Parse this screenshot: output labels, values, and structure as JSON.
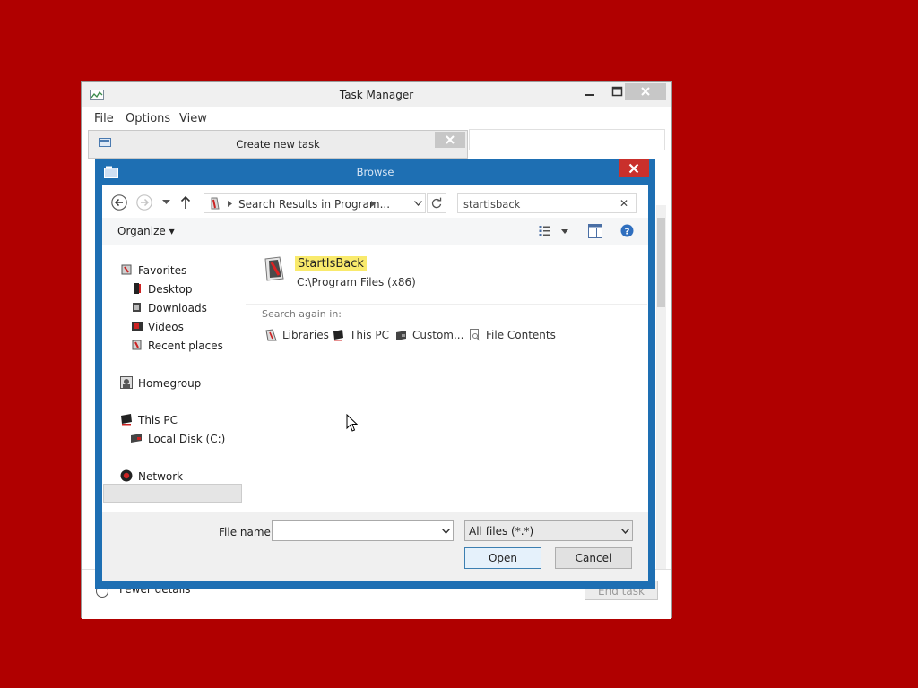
{
  "task_manager": {
    "title": "Task Manager",
    "menu": [
      "File",
      "Options",
      "View"
    ],
    "fewer_details": "Fewer details",
    "end_task": "End task"
  },
  "create_task": {
    "title": "Create new task"
  },
  "browse": {
    "title": "Browse",
    "address": "Search Results in Program...",
    "search_value": "startisback",
    "organize": "Organize",
    "nav": {
      "favorites": "Favorites",
      "desktop": "Desktop",
      "downloads": "Downloads",
      "videos": "Videos",
      "recent": "Recent places",
      "homegroup": "Homegroup",
      "this_pc": "This PC",
      "local_disk": "Local Disk (C:)",
      "network": "Network"
    },
    "result": {
      "name": "StartIsBack",
      "path": "C:\\Program Files (x86)"
    },
    "search_again": {
      "label": "Search again in:",
      "options": [
        "Libraries",
        "This PC",
        "Custom...",
        "File Contents"
      ]
    },
    "file_name_label": "File name:",
    "file_name_value": "",
    "file_type": "All files (*.*)",
    "open": "Open",
    "cancel": "Cancel"
  },
  "colors": {
    "desktop": "#b00000",
    "dialog_frame": "#1e6fb3",
    "close_red": "#c9302c",
    "highlight": "#f9ea6c"
  }
}
